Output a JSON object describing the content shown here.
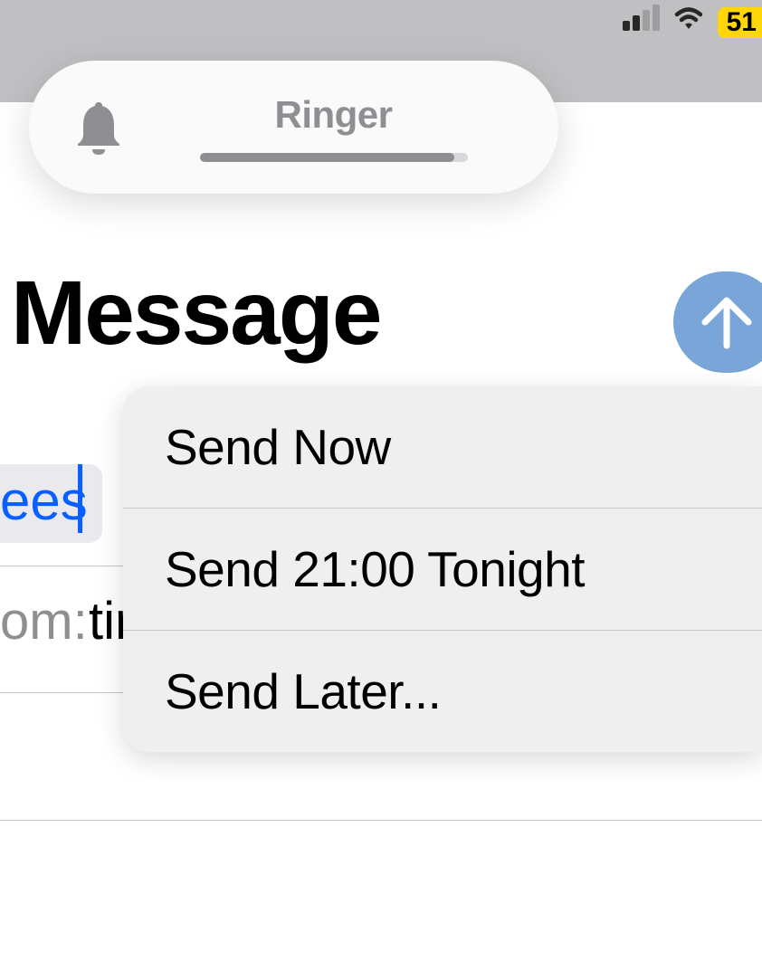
{
  "status_bar": {
    "battery_level": "51",
    "cellular_bars_active": 2,
    "cellular_bars_total": 4
  },
  "ringer_hud": {
    "label": "Ringer",
    "volume_percent": 95
  },
  "page": {
    "title": "Message"
  },
  "recipient": {
    "visible_fragment": "ees"
  },
  "from_row": {
    "label": "om:",
    "value_fragment": "tir"
  },
  "send_menu": {
    "options": [
      {
        "label": "Send Now"
      },
      {
        "label": "Send 21:00 Tonight"
      },
      {
        "label": "Send Later..."
      }
    ]
  }
}
